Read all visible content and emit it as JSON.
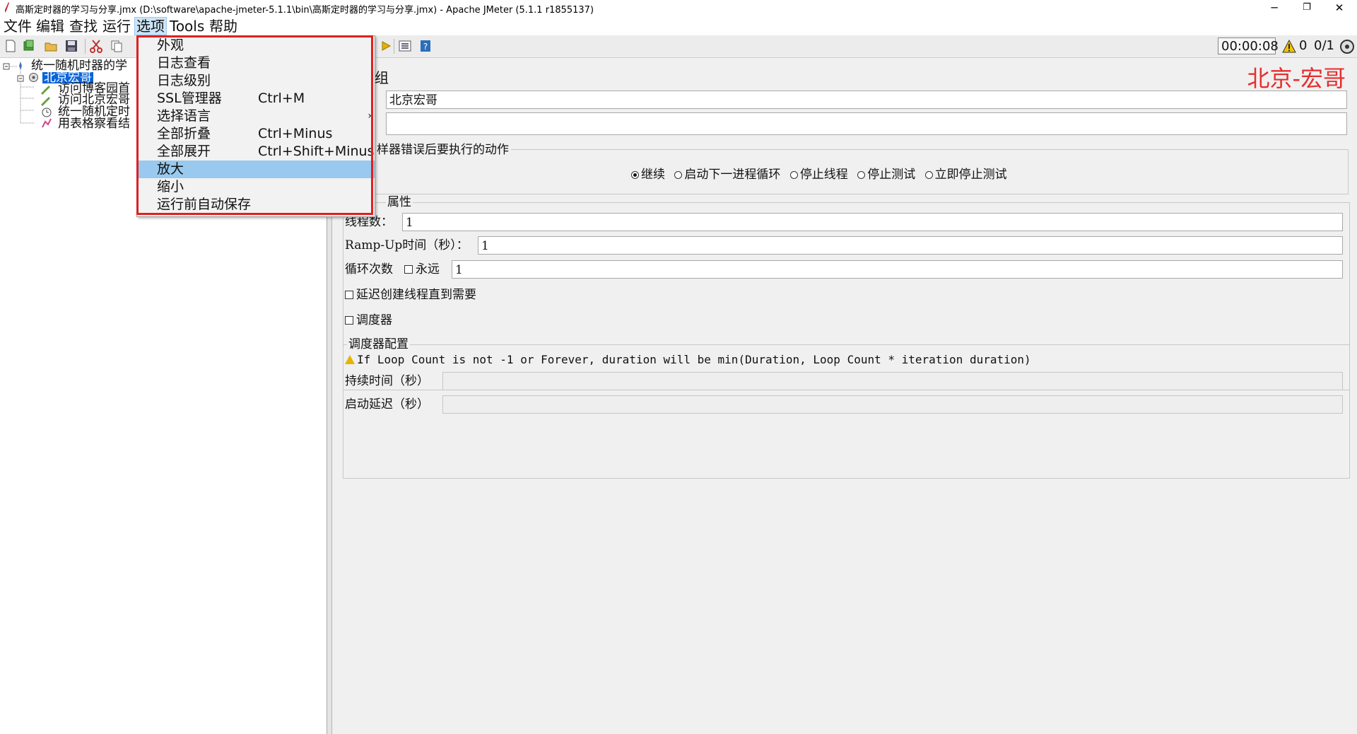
{
  "window": {
    "title": "高斯定时器的学习与分享.jmx (D:\\software\\apache-jmeter-5.1.1\\bin\\高斯定时器的学习与分享.jmx) - Apache JMeter (5.1.1 r1855137)",
    "minimize": "─",
    "restore": "❐",
    "close": "✕"
  },
  "menubar": {
    "items": [
      "文件",
      "编辑",
      "查找",
      "运行",
      "选项",
      "Tools",
      "帮助"
    ],
    "active": "选项"
  },
  "toolbar": {
    "timer": "00:00:08",
    "warning_count": "0",
    "threads": "0/1"
  },
  "tree": {
    "root": "统一随机时器的学",
    "selected": "北京宏哥",
    "children": [
      "访问博客园首",
      "访问北京宏哥",
      "统一随机定时",
      "用表格察看结"
    ]
  },
  "dropdown": {
    "items": [
      {
        "label": "外观",
        "accel": ""
      },
      {
        "label": "日志查看",
        "accel": ""
      },
      {
        "label": "日志级别",
        "accel": ""
      },
      {
        "label": "SSL管理器",
        "accel": "Ctrl+M"
      },
      {
        "label": "选择语言",
        "accel": ""
      },
      {
        "label": "全部折叠",
        "accel": "Ctrl+Minus"
      },
      {
        "label": "全部展开",
        "accel": "Ctrl+Shift+Minus"
      },
      {
        "label": "放大",
        "accel": ""
      },
      {
        "label": "缩小",
        "accel": ""
      },
      {
        "label": "运行前自动保存",
        "accel": ""
      }
    ],
    "highlighted": "放大"
  },
  "panel": {
    "heading_fragment": "组",
    "name_value": "北京宏哥",
    "comment_value": "",
    "error_action_title": "样器错误后要执行的动作",
    "error_actions": [
      "继续",
      "启动下一进程循环",
      "停止线程",
      "停止测试",
      "立即停止测试"
    ],
    "selected_action": "继续",
    "thread_props_title": "属性",
    "threads_label": "线程数：",
    "threads_value": "1",
    "rampup_label": "Ramp-Up时间（秒）：",
    "rampup_value": "1",
    "loop_label": "循环次数",
    "forever_label": "永远",
    "loop_value": "1",
    "delay_label": "延迟创建线程直到需要",
    "scheduler_label": "调度器",
    "scheduler_config_title": "调度器配置",
    "scheduler_warning": "If Loop Count is not -1 or Forever, duration will be min(Duration, Loop Count * iteration duration)",
    "duration_label": "持续时间（秒）",
    "duration_value": "",
    "startup_delay_label": "启动延迟（秒）",
    "startup_delay_value": ""
  },
  "watermark": "北京-宏哥"
}
